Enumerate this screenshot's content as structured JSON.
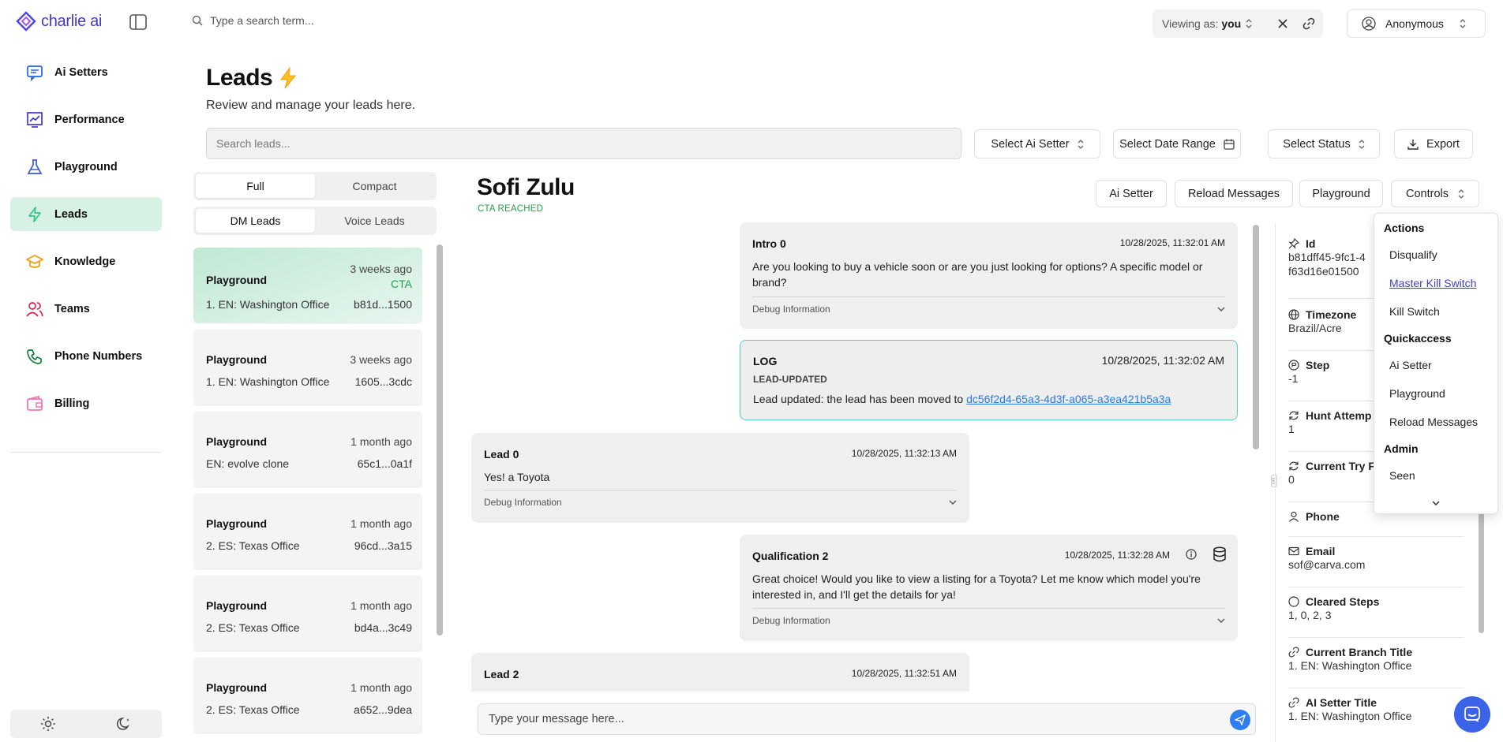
{
  "app": {
    "name": "charlie ai",
    "accent": "#4f46e5"
  },
  "sidebar": {
    "items": [
      {
        "label": "Ai Setters",
        "icon": "chat-icon"
      },
      {
        "label": "Performance",
        "icon": "chart-icon"
      },
      {
        "label": "Playground",
        "icon": "flask-icon"
      },
      {
        "label": "Leads",
        "icon": "bolt-icon",
        "active": true
      },
      {
        "label": "Knowledge",
        "icon": "graduation-cap-icon"
      },
      {
        "label": "Teams",
        "icon": "users-icon"
      },
      {
        "label": "Phone Numbers",
        "icon": "phone-icon"
      },
      {
        "label": "Billing",
        "icon": "wallet-icon"
      }
    ]
  },
  "topbar": {
    "search_placeholder": "Type a search term...",
    "viewing_label": "Viewing as:",
    "viewing_value": "you",
    "user_name": "Anonymous"
  },
  "page": {
    "title": "Leads",
    "subtitle": "Review and manage your leads here.",
    "search_placeholder": "Search leads...",
    "filters": {
      "ai_setter": "Select Ai Setter",
      "date_range": "Select Date Range",
      "status": "Select Status",
      "export": "Export"
    }
  },
  "view_toggle": {
    "full": "Full",
    "compact": "Compact"
  },
  "lead_type_toggle": {
    "dm": "DM Leads",
    "voice": "Voice Leads"
  },
  "leads": [
    {
      "title": "Playground",
      "time": "3 weeks ago",
      "badge": "CTA",
      "office": "1. EN: Washington Office",
      "id": "b81d...1500"
    },
    {
      "title": "Playground",
      "time": "3 weeks ago",
      "badge": "",
      "office": "1. EN: Washington Office",
      "id": "1605...3cdc"
    },
    {
      "title": "Playground",
      "time": "1 month ago",
      "badge": "",
      "office": "EN: evolve clone",
      "id": "65c1...0a1f"
    },
    {
      "title": "Playground",
      "time": "1 month ago",
      "badge": "",
      "office": "2. ES: Texas Office",
      "id": "96cd...3a15"
    },
    {
      "title": "Playground",
      "time": "1 month ago",
      "badge": "",
      "office": "2. ES: Texas Office",
      "id": "bd4a...3c49"
    },
    {
      "title": "Playground",
      "time": "1 month ago",
      "badge": "",
      "office": "2. ES: Texas Office",
      "id": "a652...9dea"
    }
  ],
  "chat": {
    "lead_name": "Sofi Zulu",
    "status": "CTA REACHED",
    "buttons": {
      "ai_setter": "Ai Setter",
      "reload": "Reload Messages",
      "playground": "Playground",
      "controls": "Controls"
    },
    "input_placeholder": "Type your message here...",
    "messages": [
      {
        "title": "Intro 0",
        "time": "10/28/2025, 11:32:01 AM",
        "body": "Are you looking to buy a vehicle soon or are you just looking for options? A specific model or brand?",
        "debug": "Debug Information"
      },
      {
        "title": "LOG",
        "time": "10/28/2025, 11:32:02 AM",
        "subtitle": "LEAD-UPDATED",
        "body_prefix": "Lead updated: the lead has been moved to ",
        "link": "dc56f2d4-65a3-4d3f-a065-a3ea421b5a3a"
      },
      {
        "title": "Lead 0",
        "time": "10/28/2025, 11:32:13 AM",
        "body": "Yes! a Toyota",
        "debug": "Debug Information"
      },
      {
        "title": "Qualification 2",
        "time": "10/28/2025, 11:32:28 AM",
        "body": "Great choice! Would you like to view a listing for a Toyota? Let me know which model you're interested in, and I'll get the details for ya!",
        "debug": "Debug Information"
      },
      {
        "title": "Lead 2",
        "time": "10/28/2025, 11:32:51 AM"
      }
    ]
  },
  "details": {
    "id": {
      "label": "Id",
      "value": "b81dff45-9fc1-4",
      "value2": "f63d16e01500"
    },
    "timezone": {
      "label": "Timezone",
      "value": "Brazil/Acre"
    },
    "step": {
      "label": "Step",
      "value": "-1"
    },
    "hunt": {
      "label": "Hunt Attemp",
      "value": "1"
    },
    "current_try": {
      "label": "Current Try F",
      "value": "0"
    },
    "phone": {
      "label": "Phone",
      "value": ""
    },
    "email": {
      "label": "Email",
      "value": "sof@carva.com"
    },
    "cleared": {
      "label": "Cleared Steps",
      "value": "1, 0, 2, 3"
    },
    "branch": {
      "label": "Current Branch Title",
      "value": "1. EN: Washington Office"
    },
    "ai_setter": {
      "label": "AI Setter Title",
      "value": "1. EN: Washington Office"
    }
  },
  "controls_menu": {
    "actions_header": "Actions",
    "disqualify": "Disqualify",
    "master_kill": "Master Kill Switch",
    "kill": "Kill Switch",
    "quick_header": "Quickaccess",
    "ai_setter": "Ai Setter",
    "playground": "Playground",
    "reload": "Reload Messages",
    "admin_header": "Admin",
    "seen": "Seen"
  }
}
